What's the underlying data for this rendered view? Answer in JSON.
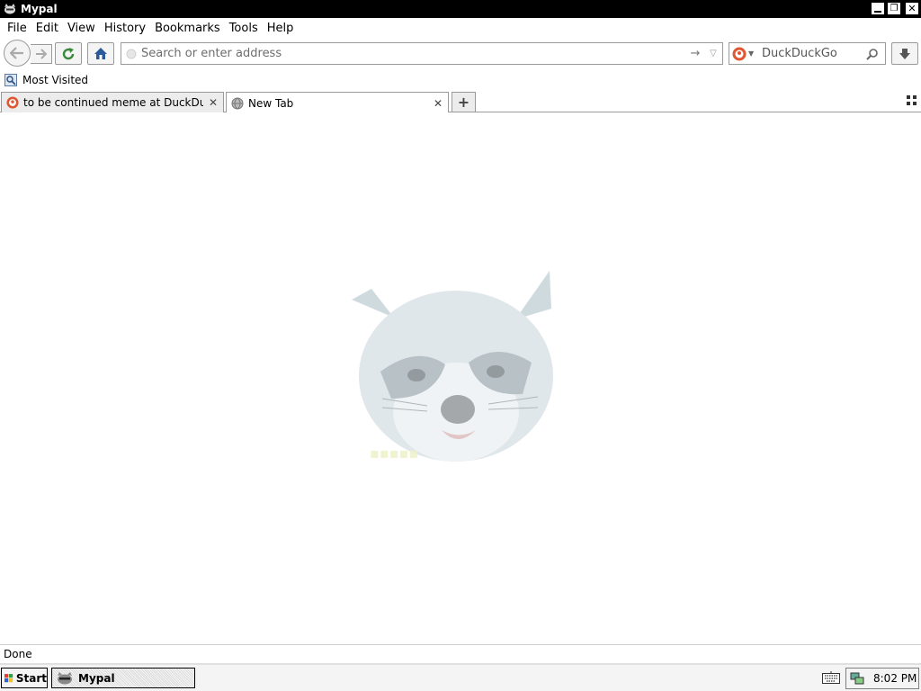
{
  "window": {
    "title": "Mypal"
  },
  "menu": [
    {
      "label": "File"
    },
    {
      "label": "Edit"
    },
    {
      "label": "View"
    },
    {
      "label": "History"
    },
    {
      "label": "Bookmarks"
    },
    {
      "label": "Tools"
    },
    {
      "label": "Help"
    }
  ],
  "navbar": {
    "url_placeholder": "Search or enter address",
    "search_placeholder": "DuckDuckGo"
  },
  "bookmarks": {
    "most_visited": "Most Visited"
  },
  "tabs": [
    {
      "label": "to be continued meme at DuckDuc_",
      "selected": false
    },
    {
      "label": "New Tab",
      "selected": true
    }
  ],
  "status": {
    "text": "Done"
  },
  "taskbar": {
    "start_label": "Start",
    "task_label": "Mypal",
    "clock": "8:02 PM"
  },
  "colors": {
    "titlebar": "#000000",
    "duckduckgo": "#de5833"
  }
}
